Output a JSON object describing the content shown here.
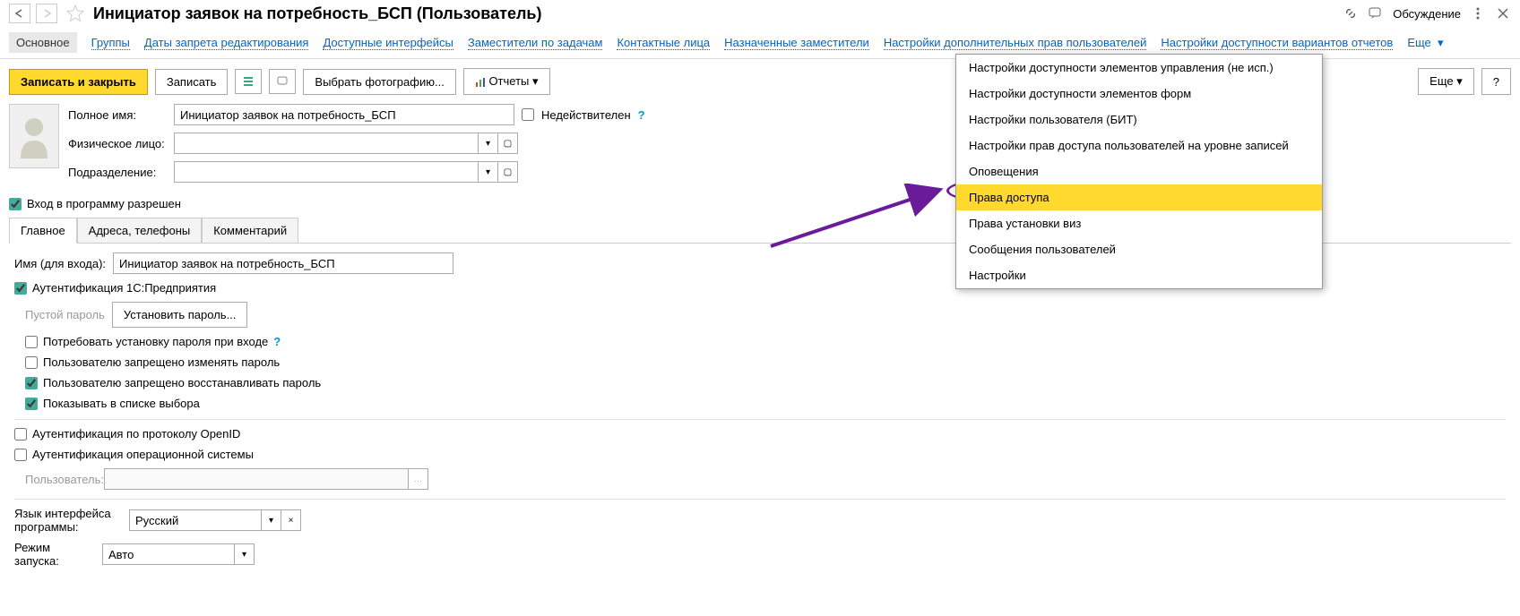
{
  "header": {
    "title": "Инициатор заявок на потребность_БСП (Пользователь)",
    "discuss_label": "Обсуждение"
  },
  "nav": {
    "main": "Основное",
    "groups": "Группы",
    "edit_ban_dates": "Даты запрета редактирования",
    "interfaces": "Доступные интерфейсы",
    "deputies_tasks": "Заместители по задачам",
    "contacts": "Контактные лица",
    "assigned_deputies": "Назначенные заместители",
    "extra_rights": "Настройки дополнительных прав пользователей",
    "report_variants": "Настройки доступности вариантов отчетов",
    "more": "Еще"
  },
  "toolbar": {
    "save_close": "Записать и закрыть",
    "save": "Записать",
    "choose_photo": "Выбрать фотографию...",
    "reports": "Отчеты",
    "more": "Еще",
    "help": "?"
  },
  "form": {
    "full_name_label": "Полное имя:",
    "full_name_value": "Инициатор заявок на потребность_БСП",
    "person_label": "Физическое лицо:",
    "department_label": "Подразделение:",
    "invalid_label": "Недействителен",
    "login_allowed": "Вход в программу разрешен"
  },
  "tabs": {
    "main": "Главное",
    "addresses": "Адреса, телефоны",
    "comment": "Комментарий"
  },
  "main_tab": {
    "login_name_label": "Имя (для входа):",
    "login_name_value": "Инициатор заявок на потребность_БСП",
    "auth_1c": "Аутентификация 1С:Предприятия",
    "empty_password": "Пустой пароль",
    "set_password": "Установить пароль...",
    "require_password_change": "Потребовать установку пароля при входе",
    "forbid_password_change": "Пользователю запрещено изменять пароль",
    "forbid_password_restore": "Пользователю запрещено восстанавливать пароль",
    "show_in_list": "Показывать в списке выбора",
    "auth_openid": "Аутентификация по протоколу OpenID",
    "auth_os": "Аутентификация операционной системы",
    "user_label": "Пользователь:",
    "language_label": "Язык интерфейса программы:",
    "language_value": "Русский",
    "launch_mode_label": "Режим запуска:",
    "launch_mode_value": "Авто"
  },
  "dropdown": {
    "items": [
      "Настройки доступности элементов управления (не исп.)",
      "Настройки доступности элементов форм",
      "Настройки пользователя (БИТ)",
      "Настройки прав доступа пользователей на уровне записей",
      "Оповещения",
      "Права доступа",
      "Права установки виз",
      "Сообщения пользователей",
      "Настройки"
    ],
    "highlighted_index": 5
  }
}
